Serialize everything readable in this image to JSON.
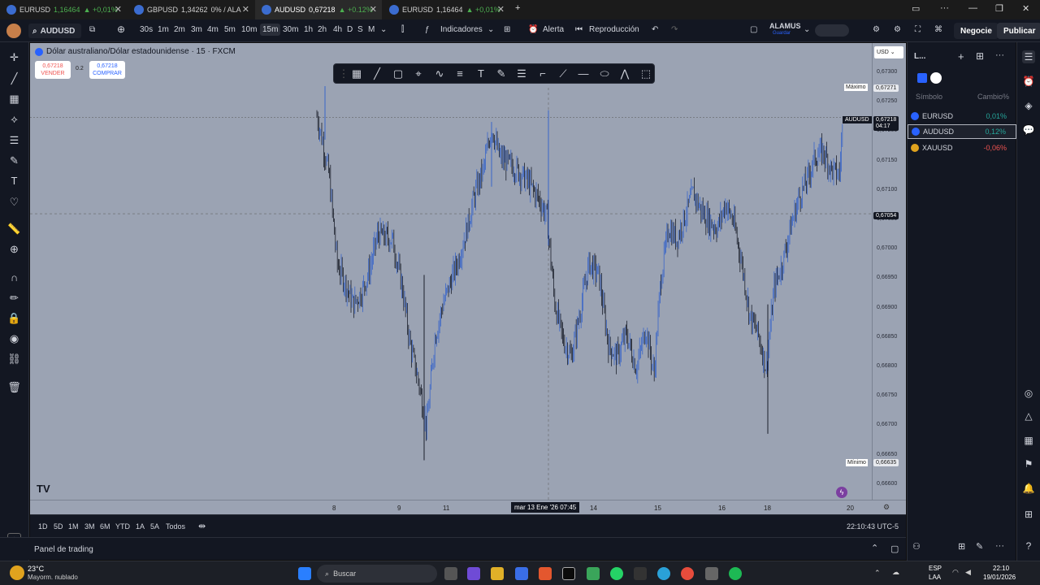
{
  "browser_tabs": [
    {
      "symbol": "EURUSD",
      "price": "1,16464",
      "change": "▲ +0,01%",
      "trend": "up"
    },
    {
      "symbol": "GBPUSD",
      "price": "1,34262",
      "change": "0% / ALA",
      "trend": "flat"
    },
    {
      "symbol": "AUDUSD",
      "price": "0,67218",
      "change": "▲ +0.12%",
      "trend": "up"
    },
    {
      "symbol": "EURUSD",
      "price": "1,16464",
      "change": "▲ +0,01%",
      "trend": "up"
    }
  ],
  "toolbar": {
    "symbol": "AUDUSD",
    "intervals": [
      "30s",
      "1m",
      "2m",
      "3m",
      "4m",
      "5m",
      "10m",
      "15m",
      "30m",
      "1h",
      "2h",
      "4h",
      "D",
      "S",
      "M"
    ],
    "selected_interval": "15m",
    "indicators_label": "Indicadores",
    "alert_label": "Alerta",
    "replay_label": "Reproducción",
    "layout_name": "ALAMUS",
    "layout_status": "Guardar",
    "trade_label": "Negocie",
    "publish_label": "Publicar"
  },
  "chart": {
    "title": "Dólar australiano/Dólar estadounidense · 15 · FXCM",
    "sell_price": "0,67218",
    "sell_label": "VENDER",
    "spread": "0.2",
    "buy_price": "0,67218",
    "buy_label": "COMPRAR",
    "currency": "USD",
    "max_label": "Máximo",
    "max_value": "0,67271",
    "min_label": "Mínimo",
    "min_value": "0,66635",
    "last_symbol": "AUDUSD",
    "last_price": "0,67218",
    "countdown": "04:17",
    "crosshair_price": "0,67054",
    "crosshair_time": "mar 13 Ene '26   07:45",
    "price_ticks": [
      "0,67300",
      "0,67250",
      "0,67200",
      "0,67150",
      "0,67100",
      "0,67050",
      "0,67000",
      "0,66950",
      "0,66900",
      "0,66850",
      "0,66800",
      "0,66750",
      "0,66700",
      "0,66650",
      "0,66600"
    ],
    "time_ticks": [
      "8",
      "9",
      "11",
      "14",
      "15",
      "16",
      "18",
      "20"
    ],
    "accent_color": "#2962ff",
    "bar_color": "#3a66c8",
    "down_color": "#1b1f2b"
  },
  "range_bar": {
    "ranges": [
      "1D",
      "5D",
      "1M",
      "3M",
      "6M",
      "YTD",
      "1A",
      "5A",
      "Todos"
    ],
    "clock": "22:10:43 UTC-5"
  },
  "panel": {
    "label": "Panel de trading"
  },
  "watchlist": {
    "title": "L...",
    "col_symbol": "Símbolo",
    "col_change": "Cambio%",
    "rows": [
      {
        "symbol": "EURUSD",
        "change": "0,01%",
        "color": "#26a69a"
      },
      {
        "symbol": "AUDUSD",
        "change": "0,12%",
        "color": "#26a69a"
      },
      {
        "symbol": "XAUUSD",
        "change": "-0,06%",
        "color": "#ef5350"
      }
    ]
  },
  "taskbar": {
    "weather_temp": "23°C",
    "weather_desc": "Mayorm. nublado",
    "search_label": "Buscar",
    "lang": "ESP",
    "lang2": "LAA",
    "time": "22:10",
    "date": "19/01/2026"
  },
  "icons": [
    "tradingview-logo",
    "crosshair-icon",
    "trendline-icon",
    "fib-icon",
    "pattern-icon",
    "brush-icon",
    "text-icon",
    "heart-icon",
    "ruler-icon",
    "zoom-icon",
    "magnet-icon",
    "lock-icon",
    "eye-icon",
    "link-icon",
    "trash-icon"
  ]
}
